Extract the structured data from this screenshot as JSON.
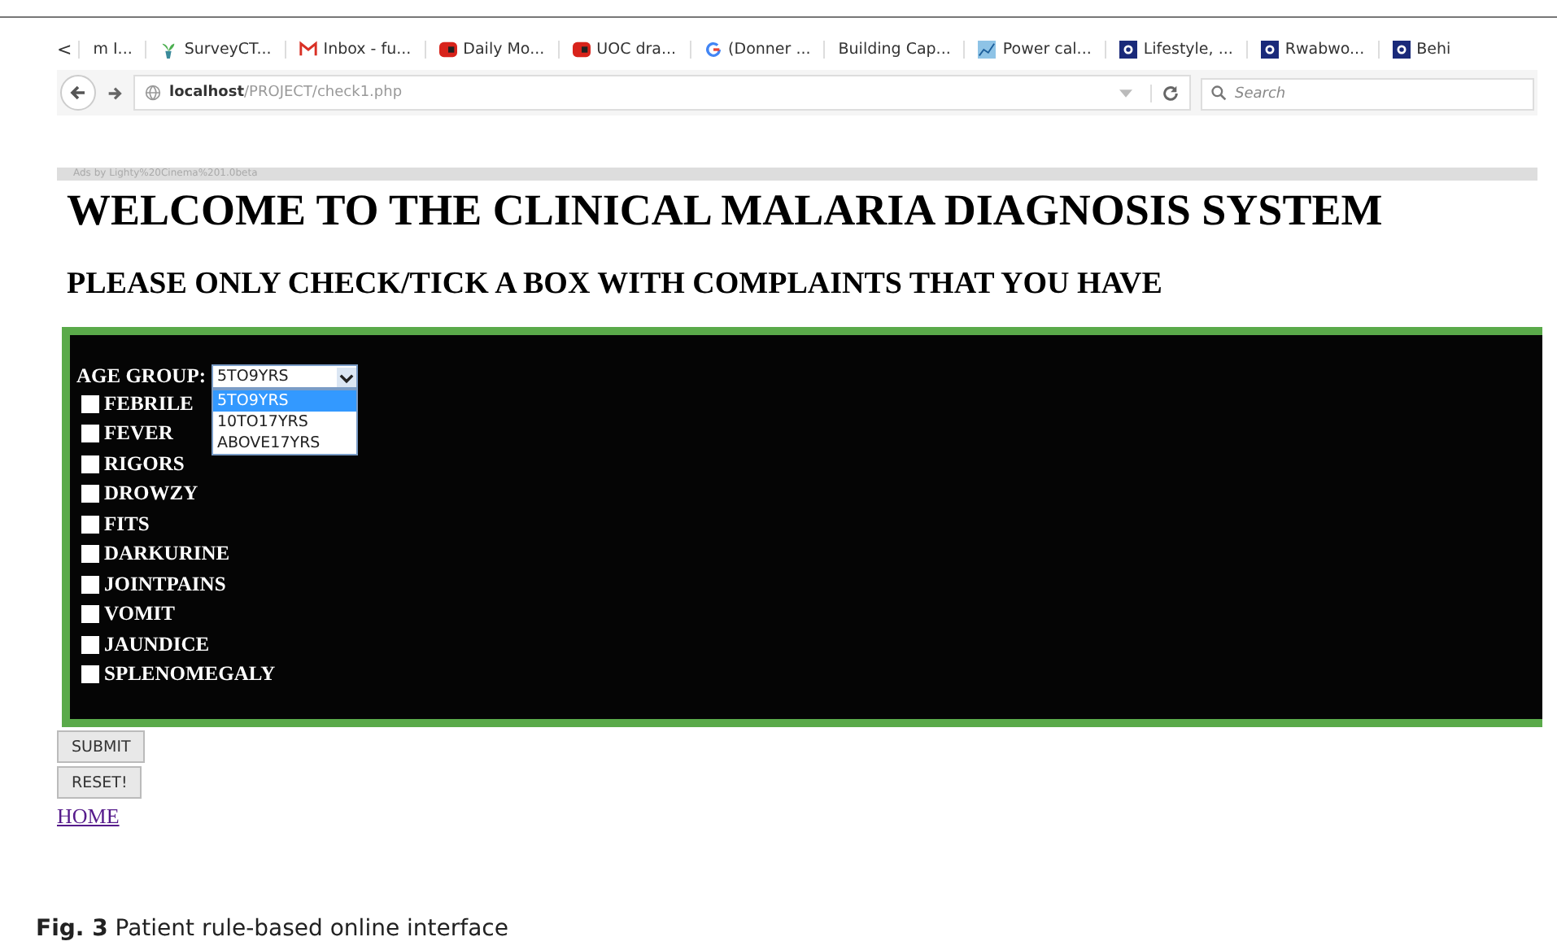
{
  "bookmarks_bar": {
    "overflow": "<",
    "items": [
      {
        "label": "m I...",
        "kind": "none"
      },
      {
        "label": "SurveyCT...",
        "kind": "plant"
      },
      {
        "label": "Inbox - fu...",
        "kind": "mail"
      },
      {
        "label": "Daily Mo...",
        "kind": "red"
      },
      {
        "label": "UOC dra...",
        "kind": "red"
      },
      {
        "label": "(Donner ...",
        "kind": "google"
      },
      {
        "label": "Building Cap...",
        "kind": "none"
      },
      {
        "label": "Power cal...",
        "kind": "chart"
      },
      {
        "label": "Lifestyle, ...",
        "kind": "blue"
      },
      {
        "label": "Rwabwo...",
        "kind": "blue"
      },
      {
        "label": "Behi",
        "kind": "blue"
      }
    ]
  },
  "address_bar": {
    "host": "localhost",
    "path": "/PROJECT/check1.php",
    "search_placeholder": "Search"
  },
  "ad_bar": "Ads by Lighty%20Cinema%201.0beta",
  "title": "WELCOME TO THE CLINICAL MALARIA DIAGNOSIS SYSTEM",
  "subtitle": "PLEASE ONLY CHECK/TICK A BOX WITH COMPLAINTS THAT YOU HAVE",
  "age_group": {
    "label": "AGE GROUP:",
    "value": "5TO9YRS",
    "expanded": true,
    "options": [
      {
        "label": "5TO9YRS",
        "selected": true
      },
      {
        "label": "10TO17YRS",
        "selected": false
      },
      {
        "label": "ABOVE17YRS",
        "selected": false
      }
    ]
  },
  "complaints": [
    {
      "label": "FEBRILE",
      "checked": false
    },
    {
      "label": "FEVER",
      "checked": false
    },
    {
      "label": "RIGORS",
      "checked": false
    },
    {
      "label": "DROWZY",
      "checked": false
    },
    {
      "label": "FITS",
      "checked": false
    },
    {
      "label": "DARKURINE",
      "checked": false
    },
    {
      "label": "JOINTPAINS",
      "checked": false
    },
    {
      "label": "VOMIT",
      "checked": false
    },
    {
      "label": "JAUNDICE",
      "checked": false
    },
    {
      "label": "SPLENOMEGALY",
      "checked": false
    }
  ],
  "buttons": [
    "SUBMIT",
    "RESET!"
  ],
  "home_link": "HOME",
  "caption": "**Fig. 3** Patient rule-based online interface"
}
